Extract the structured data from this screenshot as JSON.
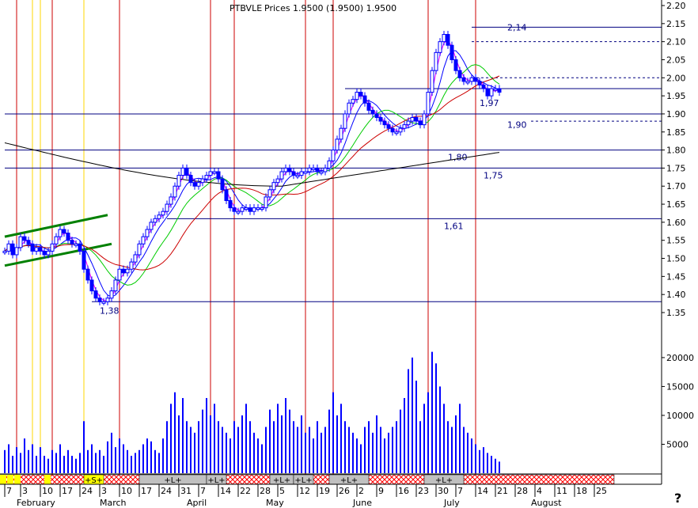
{
  "chart_data": {
    "type": "candlestick",
    "title": "PTBVLE",
    "overlapping_title_text": "Prices 1.9500 (1.9500) 1.9500",
    "help_glyph": "?",
    "ylim": [
      1.35,
      2.2
    ],
    "price_ticks": [
      "1.35",
      "1.40",
      "1.45",
      "1.50",
      "1.55",
      "1.60",
      "1.65",
      "1.70",
      "1.75",
      "1.80",
      "1.85",
      "1.90",
      "1.95",
      "2.00",
      "2.05",
      "2.10",
      "2.15",
      "2.20"
    ],
    "volume_ylim": [
      0,
      23000
    ],
    "volume_ticks": [
      "5000",
      "10000",
      "15000",
      "20000"
    ],
    "x_axis": {
      "day_ticks": [
        {
          "label": "7",
          "i": 0
        },
        {
          "label": "3",
          "i": 4
        },
        {
          "label": "10",
          "i": 9
        },
        {
          "label": "17",
          "i": 14
        },
        {
          "label": "24",
          "i": 19
        },
        {
          "label": "3",
          "i": 24
        },
        {
          "label": "10",
          "i": 29
        },
        {
          "label": "17",
          "i": 34
        },
        {
          "label": "24",
          "i": 39
        },
        {
          "label": "31",
          "i": 44
        },
        {
          "label": "7",
          "i": 49
        },
        {
          "label": "14",
          "i": 54
        },
        {
          "label": "22",
          "i": 59
        },
        {
          "label": "28",
          "i": 64
        },
        {
          "label": "5",
          "i": 69
        },
        {
          "label": "12",
          "i": 74
        },
        {
          "label": "19",
          "i": 79
        },
        {
          "label": "26",
          "i": 84
        },
        {
          "label": "2",
          "i": 89
        },
        {
          "label": "9",
          "i": 94
        },
        {
          "label": "16",
          "i": 99
        },
        {
          "label": "23",
          "i": 104
        },
        {
          "label": "30",
          "i": 109
        },
        {
          "label": "7",
          "i": 114
        },
        {
          "label": "14",
          "i": 119
        },
        {
          "label": "21",
          "i": 124
        },
        {
          "label": "28",
          "i": 129
        },
        {
          "label": "4",
          "i": 134
        },
        {
          "label": "11",
          "i": 139
        },
        {
          "label": "18",
          "i": 144
        },
        {
          "label": "25",
          "i": 149
        }
      ],
      "months": [
        {
          "label": "February",
          "i": 3
        },
        {
          "label": "March",
          "i": 24
        },
        {
          "label": "April",
          "i": 46
        },
        {
          "label": "May",
          "i": 66
        },
        {
          "label": "June",
          "i": 88
        },
        {
          "label": "July",
          "i": 111
        },
        {
          "label": "August",
          "i": 133
        }
      ]
    },
    "horizontal_levels": [
      {
        "value": 2.14,
        "label": "2,14",
        "style": "solid",
        "from_i": 118
      },
      {
        "value": 2.1,
        "label": "",
        "style": "dashed",
        "from_i": 118
      },
      {
        "value": 2.0,
        "label": "",
        "style": "dashed",
        "from_i": 118
      },
      {
        "value": 1.97,
        "label": "1,97",
        "style": "solid",
        "from_i": 86
      },
      {
        "value": 1.9,
        "label": "1,90",
        "style": "solid",
        "from_i": 0
      },
      {
        "value": 1.88,
        "label": "",
        "style": "dashed",
        "from_i": 133
      },
      {
        "value": 1.8,
        "label": "1,80",
        "style": "solid",
        "from_i": 0
      },
      {
        "value": 1.75,
        "label": "1,75",
        "style": "solid",
        "from_i": 0
      },
      {
        "value": 1.61,
        "label": "1,61",
        "style": "solid",
        "from_i": 41
      },
      {
        "value": 1.38,
        "label": "1,38",
        "style": "solid",
        "from_i": 22
      }
    ],
    "level_label_positions": [
      {
        "label": "2,14",
        "i": 127,
        "value": 2.14
      },
      {
        "label": "1,97",
        "i": 120,
        "value": 1.93
      },
      {
        "label": "1,90",
        "i": 127,
        "value": 1.87
      },
      {
        "label": "1,80",
        "i": 112,
        "value": 1.78
      },
      {
        "label": "1,75",
        "i": 121,
        "value": 1.73
      },
      {
        "label": "1,61",
        "i": 111,
        "value": 1.59
      },
      {
        "label": "1,38",
        "i": 24,
        "value": 1.355
      }
    ],
    "vertical_red_lines_i": [
      3,
      12,
      29,
      52,
      58,
      76,
      83,
      107,
      119
    ],
    "vertical_yellow_lines_i": [
      7,
      9,
      20
    ],
    "trend_channel": [
      {
        "from": {
          "i": 0,
          "value": 1.56
        },
        "to": {
          "i": 26,
          "value": 1.62
        }
      },
      {
        "from": {
          "i": 0,
          "value": 1.48
        },
        "to": {
          "i": 27,
          "value": 1.54
        }
      }
    ],
    "closes": [
      1.52,
      1.54,
      1.51,
      1.53,
      1.56,
      1.55,
      1.54,
      1.52,
      1.53,
      1.52,
      1.51,
      1.52,
      1.54,
      1.56,
      1.58,
      1.57,
      1.55,
      1.54,
      1.54,
      1.52,
      1.47,
      1.44,
      1.41,
      1.39,
      1.38,
      1.38,
      1.39,
      1.41,
      1.44,
      1.47,
      1.46,
      1.47,
      1.49,
      1.51,
      1.54,
      1.56,
      1.58,
      1.6,
      1.61,
      1.62,
      1.63,
      1.65,
      1.67,
      1.7,
      1.73,
      1.75,
      1.73,
      1.71,
      1.7,
      1.71,
      1.72,
      1.73,
      1.74,
      1.74,
      1.72,
      1.69,
      1.66,
      1.64,
      1.63,
      1.63,
      1.64,
      1.64,
      1.63,
      1.64,
      1.64,
      1.64,
      1.67,
      1.69,
      1.71,
      1.72,
      1.74,
      1.75,
      1.74,
      1.73,
      1.73,
      1.74,
      1.74,
      1.75,
      1.75,
      1.74,
      1.74,
      1.75,
      1.77,
      1.8,
      1.83,
      1.86,
      1.9,
      1.93,
      1.94,
      1.96,
      1.95,
      1.93,
      1.91,
      1.9,
      1.89,
      1.88,
      1.87,
      1.86,
      1.85,
      1.85,
      1.86,
      1.87,
      1.88,
      1.89,
      1.88,
      1.87,
      1.9,
      1.96,
      2.02,
      2.07,
      2.1,
      2.12,
      2.09,
      2.05,
      2.02,
      2.0,
      1.99,
      1.99,
      2.0,
      1.99,
      1.98,
      1.97,
      1.95,
      1.97,
      1.97,
      1.96
    ],
    "volumes": [
      4000,
      5000,
      3000,
      4500,
      3500,
      6000,
      4000,
      5000,
      3000,
      4500,
      3000,
      2500,
      4000,
      3500,
      5000,
      3000,
      4000,
      3000,
      2500,
      3500,
      9000,
      4000,
      5000,
      3500,
      4000,
      3000,
      5500,
      7000,
      4500,
      6000,
      5000,
      4000,
      3000,
      3500,
      4000,
      5000,
      6000,
      5500,
      4000,
      3500,
      6000,
      9000,
      12000,
      14000,
      10000,
      13000,
      9000,
      8000,
      7000,
      9000,
      11000,
      13000,
      10000,
      12000,
      9000,
      8000,
      7000,
      6000,
      9000,
      8000,
      10000,
      12000,
      9000,
      7000,
      6000,
      5000,
      8000,
      11000,
      9000,
      12000,
      10000,
      13000,
      11000,
      9000,
      8000,
      10000,
      7000,
      8000,
      6000,
      9000,
      7000,
      8000,
      11000,
      14000,
      10000,
      12000,
      9000,
      8000,
      7000,
      6000,
      5000,
      8000,
      9000,
      7000,
      10000,
      8000,
      6000,
      7000,
      8000,
      9000,
      11000,
      13000,
      18000,
      20000,
      16000,
      9000,
      12000,
      14000,
      21000,
      19000,
      15000,
      12000,
      9000,
      8000,
      10000,
      12000,
      8000,
      7000,
      6000,
      5000,
      4000,
      4500,
      3500,
      3000,
      2500,
      2000
    ],
    "bottom_signal_labels": [
      {
        "label": "+S+",
        "from_i": 20,
        "to_i": 25,
        "color": "#ffff00"
      },
      {
        "label": "+L+",
        "from_i": 34,
        "to_i": 51,
        "color": "#c0c0c0"
      },
      {
        "label": "+L+",
        "from_i": 51,
        "to_i": 56,
        "color": "#c0c0c0"
      },
      {
        "label": "+L+",
        "from_i": 67,
        "to_i": 73,
        "color": "#c0c0c0"
      },
      {
        "label": "+L+",
        "from_i": 73,
        "to_i": 78,
        "color": "#c0c0c0"
      },
      {
        "label": "+L+",
        "from_i": 82,
        "to_i": 92,
        "color": "#c0c0c0"
      },
      {
        "label": "+L+",
        "from_i": 106,
        "to_i": 116,
        "color": "#c0c0c0"
      }
    ],
    "colors": {
      "up_candle": "#ffffff",
      "down_candle": "#0000ff",
      "candle_outline": "#0000ff",
      "red_line": "#cc0000",
      "yellow_line": "#ffd700",
      "level_line": "#000080",
      "level_label": "#000080",
      "ma_fast": "#ff00ff",
      "ma_blue": "#0000ff",
      "ma_green": "#00cc00",
      "ma_red": "#cc0000",
      "ma_long": "#000000",
      "trend_channel": "#008000",
      "volume_bar": "#0000ff",
      "hatch": "#ff0000"
    }
  }
}
